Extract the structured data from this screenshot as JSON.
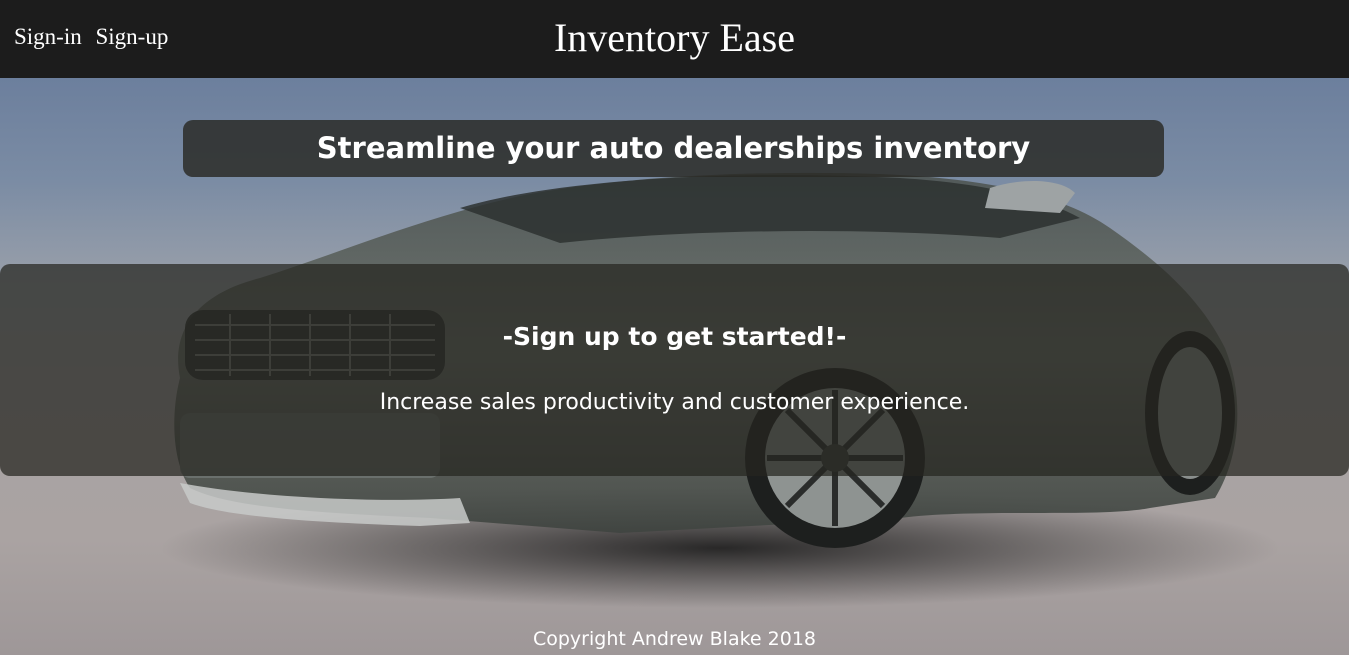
{
  "header": {
    "nav": [
      {
        "label": "Sign-in"
      },
      {
        "label": "Sign-up"
      }
    ],
    "brand": "Inventory Ease"
  },
  "hero": {
    "tagline": "Streamline your auto dealerships inventory",
    "cta_heading": "-Sign up to get started!-",
    "cta_subtext": "Increase sales productivity and customer experience."
  },
  "footer": {
    "copyright": "Copyright Andrew Blake 2018"
  },
  "background_image": "car-hero-image"
}
